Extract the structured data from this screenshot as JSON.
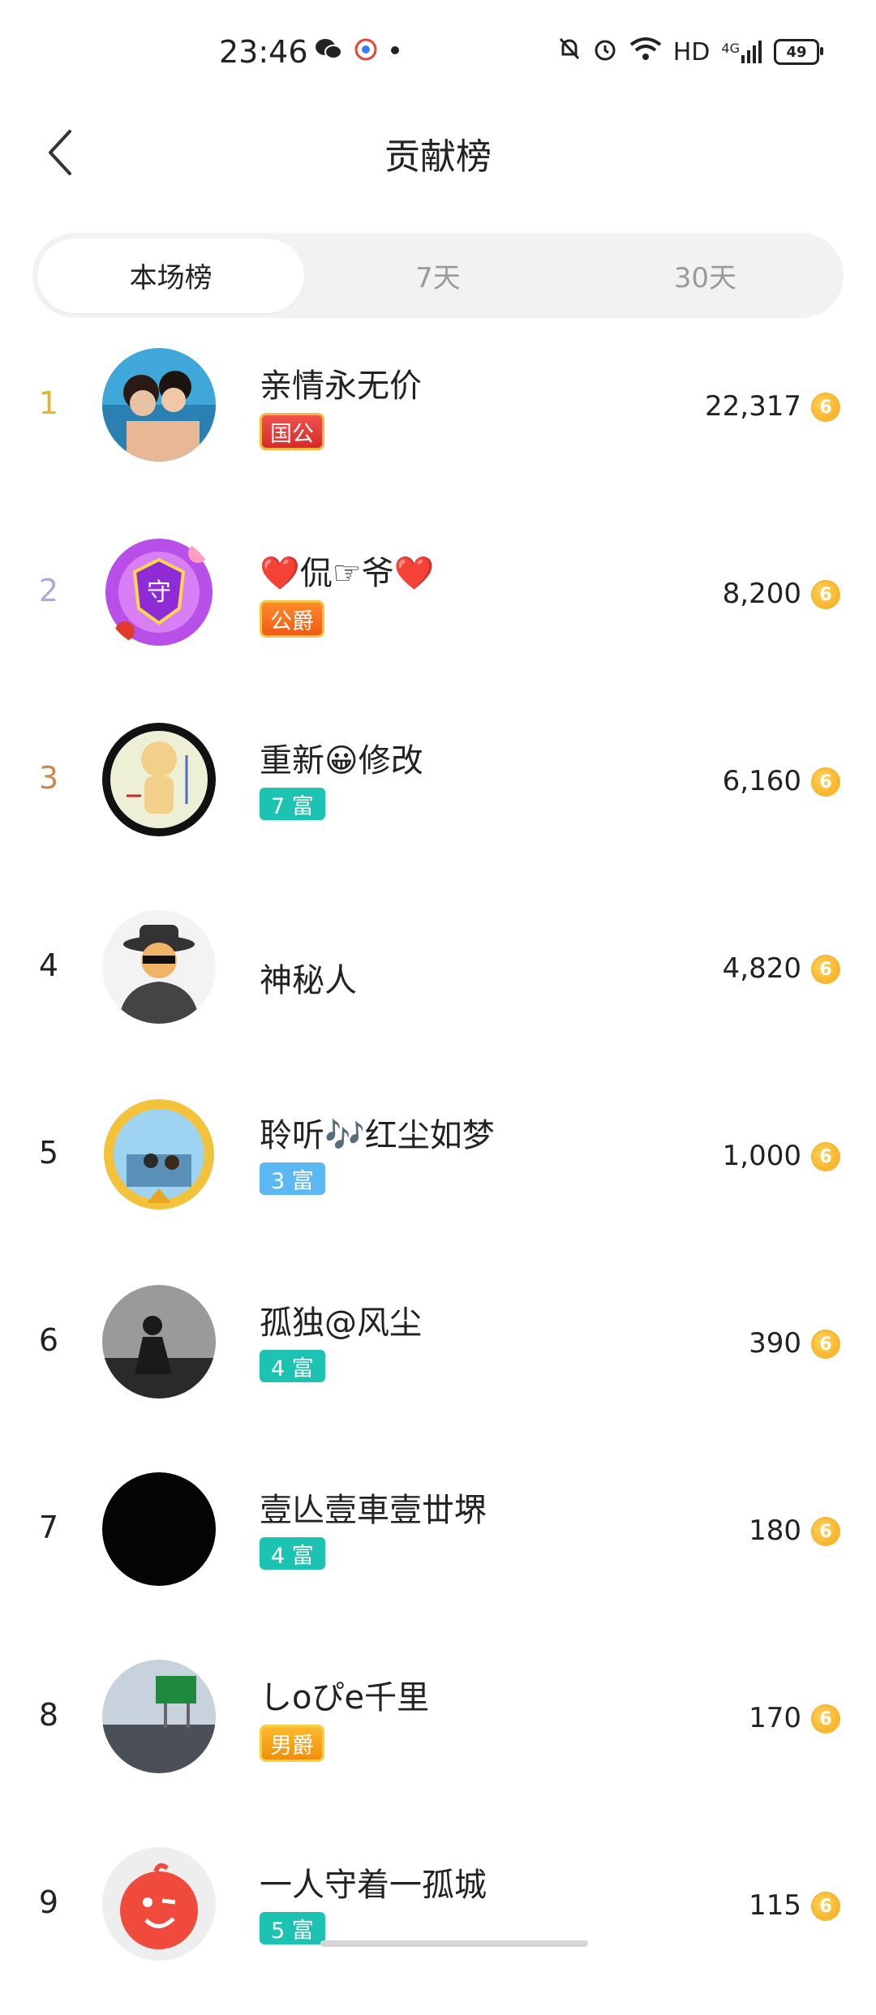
{
  "status_bar": {
    "time": "23:46",
    "network": "HD",
    "signal": "4G",
    "battery": "49",
    "icons": [
      "wechat-icon",
      "app-icon",
      "dot-icon",
      "bell-off-icon",
      "alarm-icon",
      "wifi-icon",
      "signal-icon"
    ]
  },
  "header": {
    "title": "贡献榜",
    "back_icon": "chevron-left-icon"
  },
  "tabs": [
    {
      "label": "本场榜",
      "active": true
    },
    {
      "label": "7天",
      "active": false
    },
    {
      "label": "30天",
      "active": false
    }
  ],
  "colors": {
    "rank1": "#e6b429",
    "rank2": "#a7aed6",
    "rank3": "#c98b54",
    "teal_badge": "#1cc3b2",
    "blue_badge": "#5cb8f2",
    "coin": "#f2a412"
  },
  "list": [
    {
      "rank": "1",
      "name": "亲情永无价",
      "badge": "国公",
      "score": "22,317"
    },
    {
      "rank": "2",
      "name": "❤️侃☞爷❤️",
      "badge": "公爵",
      "score": "8,200"
    },
    {
      "rank": "3",
      "name": "重新😀修改",
      "badge": "7 富",
      "score": "6,160"
    },
    {
      "rank": "4",
      "name": "神秘人",
      "badge": "",
      "score": "4,820"
    },
    {
      "rank": "5",
      "name": "聆听🎶红尘如梦",
      "badge": "3 富",
      "score": "1,000"
    },
    {
      "rank": "6",
      "name": "孤独@风尘",
      "badge": "4 富",
      "score": "390"
    },
    {
      "rank": "7",
      "name": "壹亾壹車壹丗堺",
      "badge": "4 富",
      "score": "180"
    },
    {
      "rank": "8",
      "name": "しoぴe千里",
      "badge": "男爵",
      "score": "170"
    },
    {
      "rank": "9",
      "name": "一人守着一孤城",
      "badge": "5 富",
      "score": "115"
    }
  ],
  "coin_symbol": "6"
}
